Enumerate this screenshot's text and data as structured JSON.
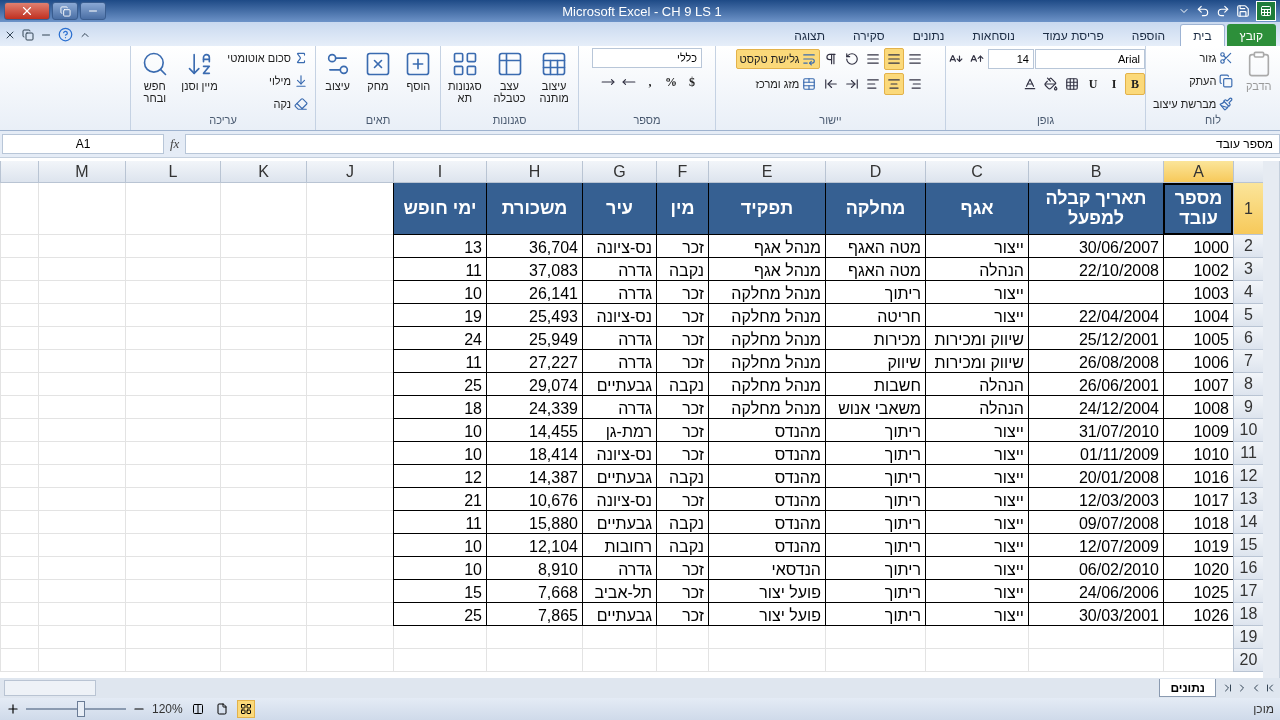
{
  "window": {
    "title": "Microsoft Excel  -  CH 9 LS 1"
  },
  "ribbon_tabs": [
    {
      "label": "קובץ",
      "kind": "file",
      "selected": false
    },
    {
      "label": "בית",
      "kind": "tab",
      "selected": true
    },
    {
      "label": "הוספה",
      "kind": "tab",
      "selected": false
    },
    {
      "label": "פריסת עמוד",
      "kind": "tab",
      "selected": false
    },
    {
      "label": "נוסחאות",
      "kind": "tab",
      "selected": false
    },
    {
      "label": "נתונים",
      "kind": "tab",
      "selected": false
    },
    {
      "label": "סקירה",
      "kind": "tab",
      "selected": false
    },
    {
      "label": "תצוגה",
      "kind": "tab",
      "selected": false
    }
  ],
  "ribbon_groups": [
    {
      "label": "לוח",
      "large": [
        {
          "label": "הדבק",
          "disabled": true
        }
      ],
      "rows": [
        [
          {
            "kind": "button",
            "label": "גזור"
          }
        ],
        [
          {
            "kind": "button",
            "label": "העתק"
          }
        ],
        [
          {
            "kind": "button",
            "label": "מברשת עיצוב"
          }
        ]
      ]
    },
    {
      "label": "גופן",
      "rows": [
        [
          {
            "kind": "field",
            "value": "Arial"
          },
          {
            "kind": "field",
            "value": "14"
          },
          {
            "kind": "toggle",
            "on": false
          },
          {
            "kind": "toggle",
            "on": false
          }
        ],
        [
          {
            "kind": "letter",
            "label": "B",
            "on": true
          },
          {
            "kind": "letter",
            "label": "I",
            "on": false
          },
          {
            "kind": "letter",
            "label": "U",
            "on": false
          },
          {
            "kind": "toggle",
            "on": false
          },
          {
            "kind": "toggle",
            "on": false
          },
          {
            "kind": "toggle",
            "on": false
          }
        ]
      ]
    },
    {
      "label": "יישור",
      "rows": [
        [
          {
            "kind": "toggle",
            "on": false
          },
          {
            "kind": "toggle",
            "on": true
          },
          {
            "kind": "toggle",
            "on": false
          },
          {
            "kind": "toggle",
            "on": false
          },
          {
            "kind": "toggle",
            "on": false
          },
          {
            "kind": "button",
            "label": "גלישת טקסט",
            "on": true
          }
        ],
        [
          {
            "kind": "toggle",
            "on": false
          },
          {
            "kind": "toggle",
            "on": true
          },
          {
            "kind": "toggle",
            "on": false
          },
          {
            "kind": "toggle",
            "on": false
          },
          {
            "kind": "toggle",
            "on": false
          },
          {
            "kind": "button",
            "label": "מזג ומרכז",
            "on": false
          }
        ]
      ]
    },
    {
      "label": "מספר",
      "rows": [
        [
          {
            "kind": "field",
            "value": "כללי"
          }
        ],
        [
          {
            "kind": "letter",
            "label": "$",
            "on": false
          },
          {
            "kind": "letter",
            "label": "%",
            "on": false
          },
          {
            "kind": "letter",
            "label": ",",
            "on": false
          },
          {
            "kind": "toggle",
            "on": false
          },
          {
            "kind": "toggle",
            "on": false
          }
        ]
      ]
    },
    {
      "label": "סגנונות",
      "large": [
        {
          "label": "עיצוב מותנה",
          "disabled": false
        },
        {
          "label": "עצב כטבלה",
          "disabled": false
        },
        {
          "label": "סגנונות תא",
          "disabled": false
        }
      ]
    },
    {
      "label": "תאים",
      "large": [
        {
          "label": "הוסף",
          "disabled": false
        },
        {
          "label": "מחק",
          "disabled": false
        },
        {
          "label": "עיצוב",
          "disabled": false
        }
      ]
    },
    {
      "label": "עריכה",
      "rows": [
        [
          {
            "kind": "button",
            "label": "סכום אוטומטי"
          }
        ],
        [
          {
            "kind": "button",
            "label": "מילוי"
          }
        ],
        [
          {
            "kind": "button",
            "label": "נקה"
          }
        ]
      ],
      "large_after": [
        {
          "label": "מיין וסנן",
          "disabled": false
        },
        {
          "label": "חפש ובחר",
          "disabled": false
        }
      ]
    }
  ],
  "formula_bar": {
    "name_box": "A1",
    "function_label": "fx",
    "formula": "מספר עובד"
  },
  "sheet": {
    "columns": [
      {
        "label": "A",
        "selected": true
      },
      {
        "label": "B",
        "selected": false
      },
      {
        "label": "C",
        "selected": false
      },
      {
        "label": "D",
        "selected": false
      },
      {
        "label": "E",
        "selected": false
      },
      {
        "label": "F",
        "selected": false
      },
      {
        "label": "G",
        "selected": false
      },
      {
        "label": "H",
        "selected": false
      },
      {
        "label": "I",
        "selected": false
      },
      {
        "label": "J",
        "selected": false
      },
      {
        "label": "K",
        "selected": false
      },
      {
        "label": "L",
        "selected": false
      },
      {
        "label": "M",
        "selected": false
      }
    ],
    "header_row": {
      "number": "1",
      "selected": true,
      "cells": [
        "מספר עובד",
        "תאריך קבלה למפעל",
        "אגף",
        "מחלקה",
        "תפקיד",
        "מין",
        "עיר",
        "משכורת",
        "ימי חופש"
      ]
    },
    "rows": [
      {
        "number": "2",
        "cells": [
          "1000",
          "30/06/2007",
          "ייצור",
          "מטה האגף",
          "מנהל אגף",
          "זכר",
          "נס-ציונה",
          "36,704",
          "13"
        ]
      },
      {
        "number": "3",
        "cells": [
          "1002",
          "22/10/2008",
          "הנהלה",
          "מטה האגף",
          "מנהל אגף",
          "נקבה",
          "גדרה",
          "37,083",
          "11"
        ]
      },
      {
        "number": "4",
        "cells": [
          "1003",
          null,
          "ייצור",
          "ריתוך",
          "מנהל מחלקה",
          "זכר",
          "גדרה",
          "26,141",
          "10"
        ]
      },
      {
        "number": "5",
        "cells": [
          "1004",
          "22/04/2004",
          "ייצור",
          "חריטה",
          "מנהל מחלקה",
          "זכר",
          "נס-ציונה",
          "25,493",
          "19"
        ]
      },
      {
        "number": "6",
        "cells": [
          "1005",
          "25/12/2001",
          "שיווק ומכירות",
          "מכירות",
          "מנהל מחלקה",
          "זכר",
          "גדרה",
          "25,949",
          "24"
        ]
      },
      {
        "number": "7",
        "cells": [
          "1006",
          "26/08/2008",
          "שיווק ומכירות",
          "שיווק",
          "מנהל מחלקה",
          "זכר",
          "גדרה",
          "27,227",
          "11"
        ]
      },
      {
        "number": "8",
        "cells": [
          "1007",
          "26/06/2001",
          "הנהלה",
          "חשבות",
          "מנהל מחלקה",
          "נקבה",
          "גבעתיים",
          "29,074",
          "25"
        ]
      },
      {
        "number": "9",
        "cells": [
          "1008",
          "24/12/2004",
          "הנהלה",
          "משאבי אנוש",
          "מנהל מחלקה",
          "זכר",
          "גדרה",
          "24,339",
          "18"
        ]
      },
      {
        "number": "10",
        "cells": [
          "1009",
          "31/07/2010",
          "ייצור",
          "ריתוך",
          "מהנדס",
          "זכר",
          "רמת-גן",
          "14,455",
          "10"
        ]
      },
      {
        "number": "11",
        "cells": [
          "1010",
          "01/11/2009",
          "ייצור",
          "ריתוך",
          "מהנדס",
          "זכר",
          "נס-ציונה",
          "18,414",
          "10"
        ]
      },
      {
        "number": "12",
        "cells": [
          "1016",
          "20/01/2008",
          "ייצור",
          "ריתוך",
          "מהנדס",
          "נקבה",
          "גבעתיים",
          "14,387",
          "12"
        ]
      },
      {
        "number": "13",
        "cells": [
          "1017",
          "12/03/2003",
          "ייצור",
          "ריתוך",
          "מהנדס",
          "זכר",
          "נס-ציונה",
          "10,676",
          "21"
        ]
      },
      {
        "number": "14",
        "cells": [
          "1018",
          "09/07/2008",
          "ייצור",
          "ריתוך",
          "מהנדס",
          "נקבה",
          "גבעתיים",
          "15,880",
          "11"
        ]
      },
      {
        "number": "15",
        "cells": [
          "1019",
          "12/07/2009",
          "ייצור",
          "ריתוך",
          "מהנדס",
          "נקבה",
          "רחובות",
          "12,104",
          "10"
        ]
      },
      {
        "number": "16",
        "cells": [
          "1020",
          "06/02/2010",
          "ייצור",
          "ריתוך",
          "הנדסאי",
          "זכר",
          "גדרה",
          "8,910",
          "10"
        ]
      },
      {
        "number": "17",
        "cells": [
          "1025",
          "24/06/2006",
          "ייצור",
          "ריתוך",
          "פועל יצור",
          "זכר",
          "תל-אביב",
          "7,668",
          "15"
        ]
      },
      {
        "number": "18",
        "cells": [
          "1026",
          "30/03/2001",
          "ייצור",
          "ריתוך",
          "פועל יצור",
          "זכר",
          "גבעתיים",
          "7,865",
          "25"
        ]
      }
    ],
    "empty_rows": [
      "19",
      "20"
    ]
  },
  "sheet_tabs": [
    {
      "label": "נתונים",
      "selected": true
    }
  ],
  "status_bar": {
    "status": "מוכן",
    "zoom": "120%",
    "zoom_slider": {
      "level": 0.55
    }
  }
}
